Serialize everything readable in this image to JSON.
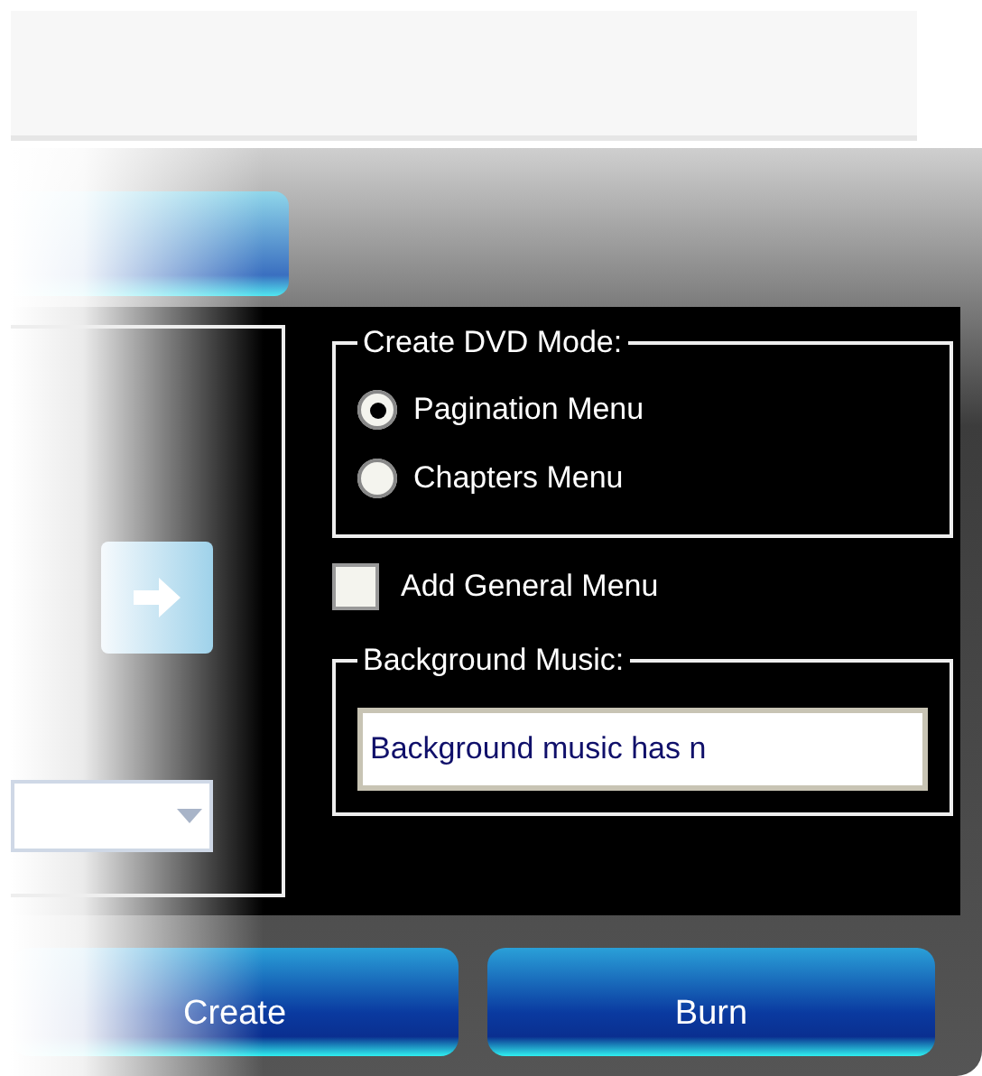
{
  "mode_group": {
    "title": "Create DVD Mode:",
    "options": [
      {
        "label": "Pagination Menu",
        "selected": true
      },
      {
        "label": "Chapters Menu",
        "selected": false
      }
    ]
  },
  "general_menu": {
    "label": "Add General Menu",
    "checked": false
  },
  "music_group": {
    "title": "Background Music:",
    "value": "Background music has n"
  },
  "buttons": [
    "Create",
    "Burn"
  ]
}
